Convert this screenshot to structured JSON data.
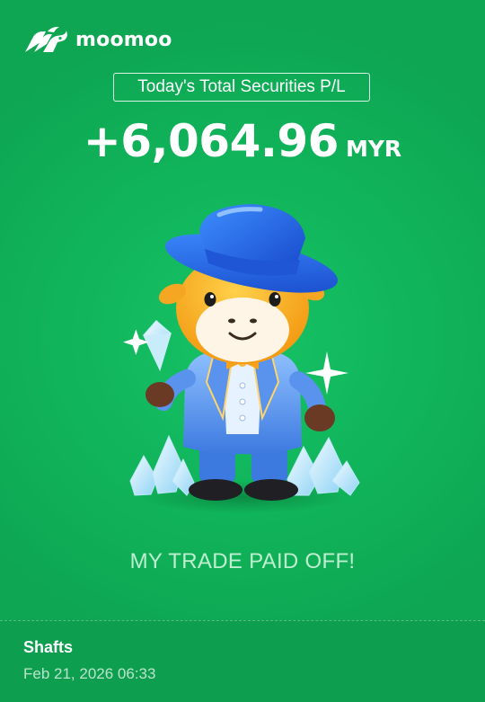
{
  "brand": {
    "name": "moomoo",
    "logo_icon": "moomoo-bull-logo-icon"
  },
  "pnl": {
    "label": "Today's Total Securities P/L",
    "value": "+6,064.96",
    "currency": "MYR"
  },
  "mascot": {
    "icon": "moomoo-bull-mascot-top-hat-diamonds-illustration"
  },
  "tagline": "MY TRADE PAID OFF!",
  "footer": {
    "username": "Shafts",
    "timestamp": "Feb 21, 2026 06:33"
  },
  "colors": {
    "background": "#10b45a",
    "footer_background": "#0e9e4f",
    "text": "#ffffff",
    "tagline": "#d2f5de"
  }
}
